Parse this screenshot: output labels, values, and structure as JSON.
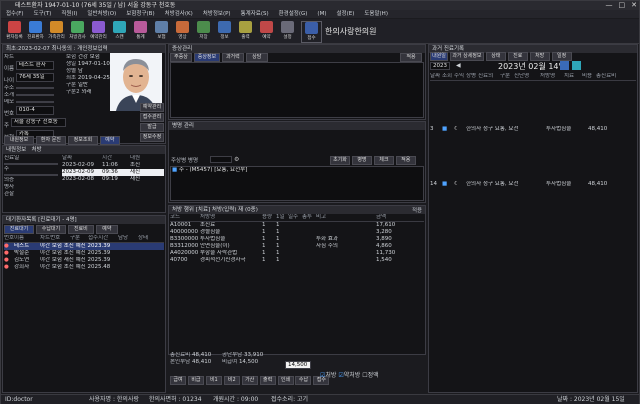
{
  "window": {
    "title": "테스트환자 1947-01-10 (76세 35일 / 남) 서울 강동구 천호동",
    "minimize": "—",
    "maximize": "□",
    "close": "✕"
  },
  "menu": [
    "접수(F)",
    "도구(T)",
    "직원(I)",
    "일반처방(O)",
    "보험청구(B)",
    "처방검사(K)",
    "처방정보(P)",
    "통계자료(S)",
    "환경설정(G)",
    "(M)",
    "설정(E)",
    "도움말(H)"
  ],
  "toolbar": {
    "buttons": [
      "환자등록",
      "진료환자",
      "가족관리",
      "처방검사",
      "예약관리",
      "스캔",
      "통계",
      "보험",
      "영상",
      "저장",
      "정보",
      "출력",
      "예약",
      "설정",
      "접수"
    ],
    "clinic_name": "한의사랑한의원"
  },
  "patient": {
    "section_label": "최초:2023-02-07 최나동의 : 개인정보입력",
    "rows": [
      {
        "label": "차트",
        "value": ""
      },
      {
        "label": "이름",
        "value": "테스트 환자"
      },
      {
        "label": "나이",
        "value": "76세 35일"
      },
      {
        "label": "주소",
        "value": ""
      },
      {
        "label": "소개",
        "value": ""
      },
      {
        "label": "메모",
        "value": ""
      },
      {
        "label": "번호",
        "value": "010-4"
      },
      {
        "label": "주",
        "value": "서울 강동구 천호동"
      },
      {
        "label": "보험",
        "value": "카톡"
      },
      {
        "label": "접수",
        "value": ""
      }
    ],
    "side_fields": [
      {
        "label": "보험",
        "value": "건강 보험"
      },
      {
        "label": "생일",
        "value": "1947-01-10"
      },
      {
        "label": "성별",
        "value": "남"
      },
      {
        "label": "최초",
        "value": "2019-04-25"
      },
      {
        "label": "구분",
        "value": "일반"
      },
      {
        "label": "구분2",
        "value": "외래"
      }
    ],
    "buttons": [
      "예약관리",
      "접수관리",
      "발급",
      "정보수정"
    ],
    "tabs": [
      "내원정보",
      "환자 문진",
      "정보조회",
      "예약"
    ]
  },
  "visit_history": {
    "tabs": [
      "내원정보",
      "처방"
    ],
    "columns": [
      "날짜",
      "시간",
      "내원"
    ],
    "rows": [
      {
        "date": "2023-02-09",
        "time": "11:06",
        "note": "초진",
        "highlight": false
      },
      {
        "date": "2023-02-09",
        "time": "09:36",
        "note": "재진",
        "highlight": true
      },
      {
        "date": "2023-02-08",
        "time": "09:19",
        "note": "재진",
        "highlight": false
      }
    ],
    "left_labels": [
      "진료일",
      "주",
      "의증",
      "병사",
      "관찰"
    ]
  },
  "waiting": {
    "title": "대기환자목록 [진료대기 - 4명]",
    "tabs": [
      "진료대기",
      "수납대기",
      "진료비",
      "예약"
    ],
    "columns": [
      "번호",
      "이름",
      "차트번호",
      "구분",
      "접수시간",
      "담당",
      "상태"
    ],
    "rows": [
      {
        "name": "테스트",
        "info": "야간 보험 초진 예진 2023.39",
        "selected": true
      },
      {
        "name": "박철순",
        "info": "야간 보험 초진 예진 2025.39",
        "selected": false
      },
      {
        "name": "김도연",
        "info": "야간 보험 재진 예진 2025.39",
        "selected": false
      },
      {
        "name": "강희자",
        "info": "야간 보험 초진 예진 2025.48",
        "selected": false
      }
    ]
  },
  "complaint": {
    "title": "증상관리",
    "tabs": [
      "주증상",
      "증상정보",
      "과거력",
      "상담"
    ],
    "button": "적용"
  },
  "diagnosis": {
    "title": "병명 관리",
    "search_label": "주상병 병명",
    "buttons": [
      "초기화",
      "병명",
      "체크",
      "적용"
    ],
    "item": "주 - (M5457) [요통, 요천부]"
  },
  "prescription": {
    "title": "처방 행위 [치료] 처방(입력) 재 (0종)",
    "columns": [
      "코드",
      "처방명",
      "용량",
      "1일",
      "일수",
      "총투",
      "비고",
      "금액"
    ],
    "rows": [
      {
        "code": "A10001",
        "name": "초진료",
        "qty": "1",
        "days": "1",
        "note": "",
        "amount": "17,610"
      },
      {
        "code": "40000000",
        "name": "경혈침술",
        "qty": "1",
        "days": "1",
        "note": "",
        "amount": "3,280"
      },
      {
        "code": "B3300000",
        "name": "투자법침술",
        "qty": "1",
        "days": "1",
        "note": "투화 효과",
        "amount": "3,890"
      },
      {
        "code": "B3312000",
        "name": "안면침술(이)",
        "qty": "1",
        "days": "1",
        "note": "자침 주의",
        "amount": "4,860"
      },
      {
        "code": "A4020000",
        "name": "부항술 자락관법",
        "qty": "1",
        "days": "1",
        "note": "",
        "amount": "11,730"
      },
      {
        "code": "40700",
        "name": "경피적전기신경자극",
        "qty": "1",
        "days": "1",
        "note": "",
        "amount": "1,540"
      }
    ],
    "side_label": "적용",
    "totals": [
      {
        "label": "총진료비",
        "value": "48,410"
      },
      {
        "label": "본인부담",
        "value": "48,410"
      },
      {
        "label": "공단부담",
        "value": "33,910"
      },
      {
        "label": "비급여",
        "value": "14,500"
      }
    ],
    "payment": "14,500",
    "bottom_buttons": [
      "급여",
      "비급",
      "비1",
      "비2",
      "가산",
      "출력",
      "인쇄",
      "수납",
      "접수"
    ],
    "checkboxes": [
      "처방",
      "약처방",
      "정액"
    ]
  },
  "history": {
    "title": "과거 진료기록",
    "tabs": [
      "내원일",
      "과거 상세정보",
      "상태",
      "진료",
      "처방",
      "일정"
    ],
    "year": "2023",
    "date_display": "2023년 02월 14일",
    "columns": [
      "날짜",
      "조회",
      "수익",
      "상병",
      "진료의",
      "구분",
      "진단명",
      "처방명",
      "치료",
      "비용",
      "총진료비"
    ],
    "rows": [
      {
        "row": "3",
        "desc": "한의사 청구 요통, 요천",
        "type": "투자법침술",
        "amount": "48,410"
      },
      {
        "row": "14",
        "desc": "한의사 청구 요통, 요천",
        "type": "투자법침술",
        "amount": "48,410"
      }
    ]
  },
  "status": {
    "id": "ID:doctor",
    "user": "사용자명 : 한의사랑",
    "license": "한의사면허 : 01234",
    "open_time": "개원시간 : 09:00",
    "reception": "접수소리: 고기",
    "date": "날짜 : 2023년 02월 15일"
  },
  "colors": {
    "accent": "#2a3b74",
    "background": "#1b1b1f",
    "highlight": "#eef0f4",
    "alert": "#ff6b6b"
  }
}
